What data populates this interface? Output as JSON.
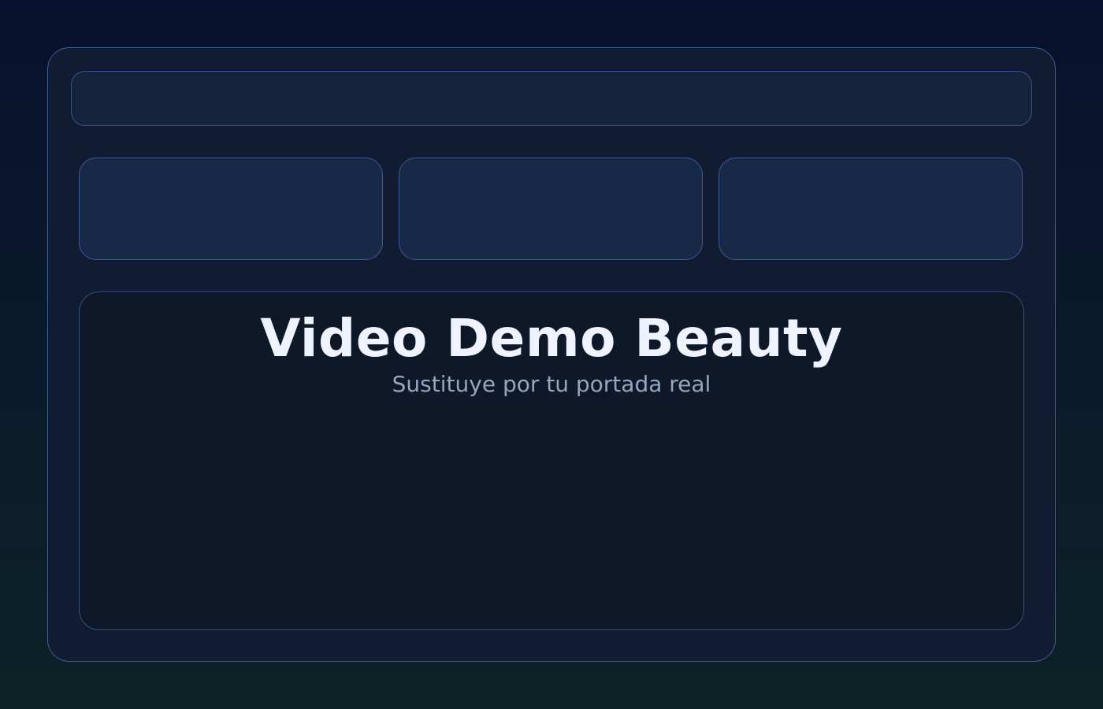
{
  "video": {
    "title": "Video Demo Beauty",
    "subtitle": "Sustituye por tu portada real"
  },
  "colors": {
    "background_top": "#08112d",
    "background_bottom": "#0b2226",
    "frame": "#111c33",
    "border": "#3e5f92",
    "card": "#172946",
    "video_panel": "#0e1828",
    "title_text": "#eef3ff",
    "subtitle_text": "#94a6c0"
  }
}
